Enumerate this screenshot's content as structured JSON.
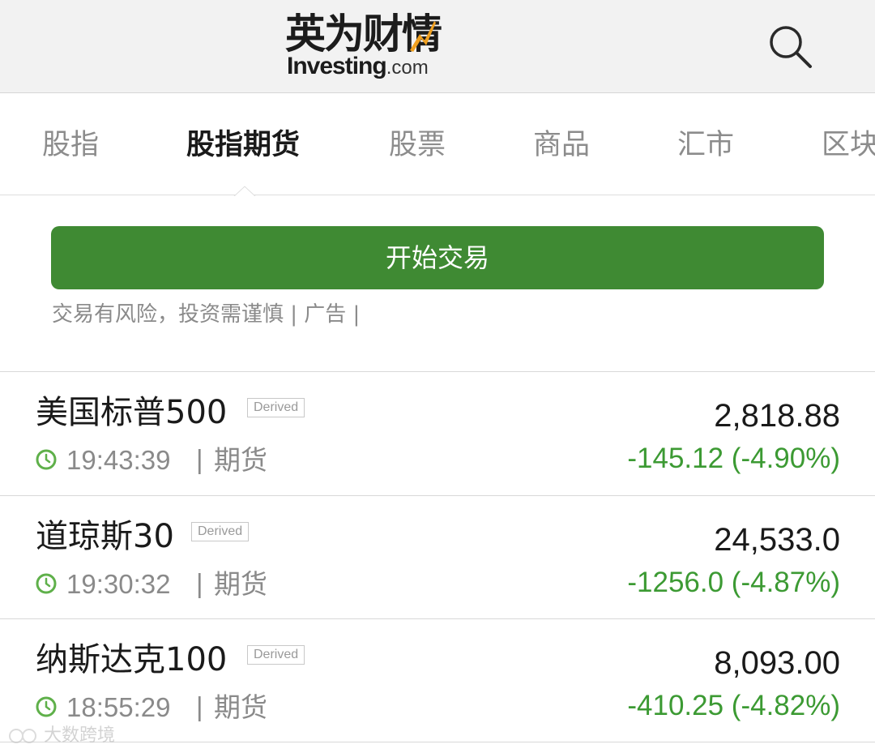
{
  "header": {
    "logo_cn": "英为财情",
    "logo_en_bold": "Investing",
    "logo_en_light": ".com",
    "search_icon": "search-icon"
  },
  "tabs": [
    {
      "label": "股指",
      "active": false
    },
    {
      "label": "股指期货",
      "active": true
    },
    {
      "label": "股票",
      "active": false
    },
    {
      "label": "商品",
      "active": false
    },
    {
      "label": "汇市",
      "active": false
    },
    {
      "label": "区块",
      "active": false
    }
  ],
  "trade": {
    "button_label": "开始交易",
    "disclaimer": "交易有风险，投资需谨慎 | 广告 |"
  },
  "rows": [
    {
      "name": "美国标普500",
      "badge": "Derived",
      "time": "19:43:39",
      "separator": "|",
      "type": "期货",
      "price": "2,818.88",
      "change": "-145.12 (-4.90%)"
    },
    {
      "name": "道琼斯30",
      "badge": "Derived",
      "time": "19:30:32",
      "separator": "|",
      "type": "期货",
      "price": "24,533.0",
      "change": "-1256.0 (-4.87%)"
    },
    {
      "name": "纳斯达克100",
      "badge": "Derived",
      "time": "18:55:29",
      "separator": "|",
      "type": "期货",
      "price": "8,093.00",
      "change": "-410.25 (-4.82%)"
    }
  ],
  "watermark": {
    "text": "大数跨境"
  },
  "colors": {
    "brand_green": "#3f8a33",
    "negative_change": "#3c9a33",
    "logo_accent": "#f0a020"
  }
}
